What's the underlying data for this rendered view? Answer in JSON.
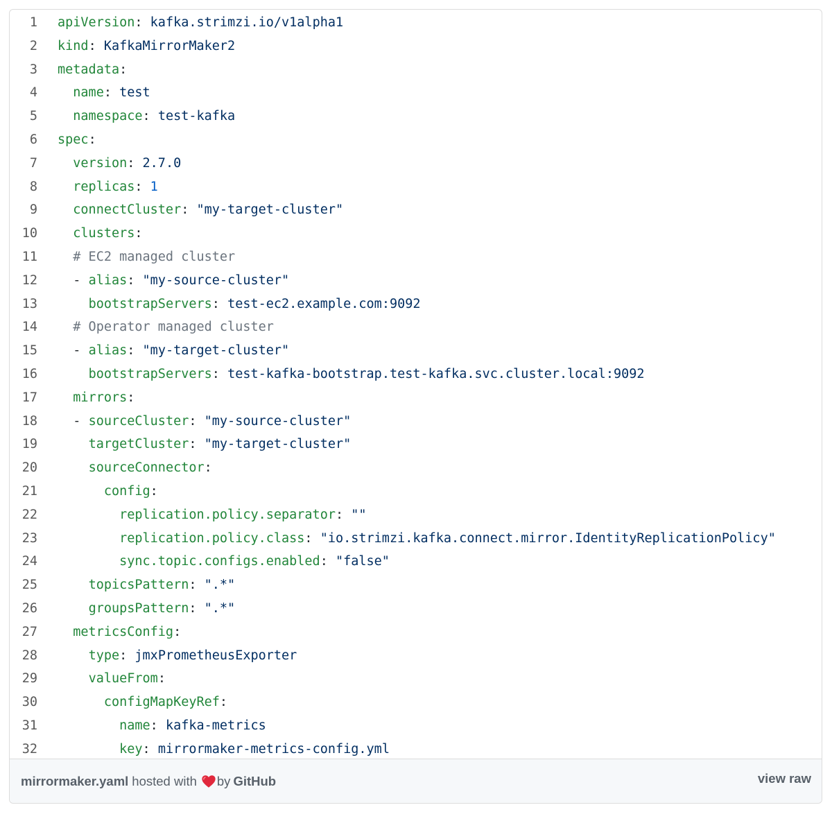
{
  "code_lines": [
    {
      "n": "1",
      "indent": "",
      "prefix": "",
      "key": "apiVersion",
      "sep": ": ",
      "value": "kafka.strimzi.io/v1alpha1",
      "vtype": "val"
    },
    {
      "n": "2",
      "indent": "",
      "prefix": "",
      "key": "kind",
      "sep": ": ",
      "value": "KafkaMirrorMaker2",
      "vtype": "val"
    },
    {
      "n": "3",
      "indent": "",
      "prefix": "",
      "key": "metadata",
      "sep": ":",
      "value": "",
      "vtype": "val"
    },
    {
      "n": "4",
      "indent": "  ",
      "prefix": "",
      "key": "name",
      "sep": ": ",
      "value": "test",
      "vtype": "val"
    },
    {
      "n": "5",
      "indent": "  ",
      "prefix": "",
      "key": "namespace",
      "sep": ": ",
      "value": "test-kafka",
      "vtype": "val"
    },
    {
      "n": "6",
      "indent": "",
      "prefix": "",
      "key": "spec",
      "sep": ":",
      "value": "",
      "vtype": "val"
    },
    {
      "n": "7",
      "indent": "  ",
      "prefix": "",
      "key": "version",
      "sep": ": ",
      "value": "2.7.0",
      "vtype": "val"
    },
    {
      "n": "8",
      "indent": "  ",
      "prefix": "",
      "key": "replicas",
      "sep": ": ",
      "value": "1",
      "vtype": "num"
    },
    {
      "n": "9",
      "indent": "  ",
      "prefix": "",
      "key": "connectCluster",
      "sep": ": ",
      "value": "\"my-target-cluster\"",
      "vtype": "val"
    },
    {
      "n": "10",
      "indent": "  ",
      "prefix": "",
      "key": "clusters",
      "sep": ":",
      "value": "",
      "vtype": "val"
    },
    {
      "n": "11",
      "indent": "  ",
      "prefix": "",
      "key": "",
      "sep": "",
      "value": "",
      "vtype": "val",
      "comment": "# EC2 managed cluster"
    },
    {
      "n": "12",
      "indent": "  ",
      "prefix": "- ",
      "key": "alias",
      "sep": ": ",
      "value": "\"my-source-cluster\"",
      "vtype": "val"
    },
    {
      "n": "13",
      "indent": "    ",
      "prefix": "",
      "key": "bootstrapServers",
      "sep": ": ",
      "value": "test-ec2.example.com:9092",
      "vtype": "val"
    },
    {
      "n": "14",
      "indent": "  ",
      "prefix": "",
      "key": "",
      "sep": "",
      "value": "",
      "vtype": "val",
      "comment": "# Operator managed cluster"
    },
    {
      "n": "15",
      "indent": "  ",
      "prefix": "- ",
      "key": "alias",
      "sep": ": ",
      "value": "\"my-target-cluster\"",
      "vtype": "val"
    },
    {
      "n": "16",
      "indent": "    ",
      "prefix": "",
      "key": "bootstrapServers",
      "sep": ": ",
      "value": "test-kafka-bootstrap.test-kafka.svc.cluster.local:9092",
      "vtype": "val"
    },
    {
      "n": "17",
      "indent": "  ",
      "prefix": "",
      "key": "mirrors",
      "sep": ":",
      "value": "",
      "vtype": "val"
    },
    {
      "n": "18",
      "indent": "  ",
      "prefix": "- ",
      "key": "sourceCluster",
      "sep": ": ",
      "value": "\"my-source-cluster\"",
      "vtype": "val"
    },
    {
      "n": "19",
      "indent": "    ",
      "prefix": "",
      "key": "targetCluster",
      "sep": ": ",
      "value": "\"my-target-cluster\"",
      "vtype": "val"
    },
    {
      "n": "20",
      "indent": "    ",
      "prefix": "",
      "key": "sourceConnector",
      "sep": ":",
      "value": "",
      "vtype": "val"
    },
    {
      "n": "21",
      "indent": "      ",
      "prefix": "",
      "key": "config",
      "sep": ":",
      "value": "",
      "vtype": "val"
    },
    {
      "n": "22",
      "indent": "        ",
      "prefix": "",
      "key": "replication.policy.separator",
      "sep": ": ",
      "value": "\"\"",
      "vtype": "val"
    },
    {
      "n": "23",
      "indent": "        ",
      "prefix": "",
      "key": "replication.policy.class",
      "sep": ": ",
      "value": "\"io.strimzi.kafka.connect.mirror.IdentityReplicationPolicy\"",
      "vtype": "val"
    },
    {
      "n": "24",
      "indent": "        ",
      "prefix": "",
      "key": "sync.topic.configs.enabled",
      "sep": ": ",
      "value": "\"false\"",
      "vtype": "val"
    },
    {
      "n": "25",
      "indent": "    ",
      "prefix": "",
      "key": "topicsPattern",
      "sep": ": ",
      "value": "\".*\"",
      "vtype": "val"
    },
    {
      "n": "26",
      "indent": "    ",
      "prefix": "",
      "key": "groupsPattern",
      "sep": ": ",
      "value": "\".*\"",
      "vtype": "val"
    },
    {
      "n": "27",
      "indent": "  ",
      "prefix": "",
      "key": "metricsConfig",
      "sep": ":",
      "value": "",
      "vtype": "val"
    },
    {
      "n": "28",
      "indent": "    ",
      "prefix": "",
      "key": "type",
      "sep": ": ",
      "value": "jmxPrometheusExporter",
      "vtype": "val"
    },
    {
      "n": "29",
      "indent": "    ",
      "prefix": "",
      "key": "valueFrom",
      "sep": ":",
      "value": "",
      "vtype": "val"
    },
    {
      "n": "30",
      "indent": "      ",
      "prefix": "",
      "key": "configMapKeyRef",
      "sep": ":",
      "value": "",
      "vtype": "val"
    },
    {
      "n": "31",
      "indent": "        ",
      "prefix": "",
      "key": "name",
      "sep": ": ",
      "value": "kafka-metrics",
      "vtype": "val"
    },
    {
      "n": "32",
      "indent": "        ",
      "prefix": "",
      "key": "key",
      "sep": ": ",
      "value": "mirrormaker-metrics-config.yml",
      "vtype": "val"
    }
  ],
  "footer": {
    "file_name": "mirrormaker.yaml",
    "hosted_text": "hosted with",
    "by_text": "by",
    "github_link": "GitHub",
    "view_raw": "view raw",
    "heart_icon": "heart-icon"
  },
  "colors": {
    "key": "#22863a",
    "string": "#032f62",
    "number": "#005cc5",
    "comment": "#6a737d",
    "line_number": "#595959",
    "footer_bg": "#f6f8fa",
    "heart": "#e0283c"
  }
}
